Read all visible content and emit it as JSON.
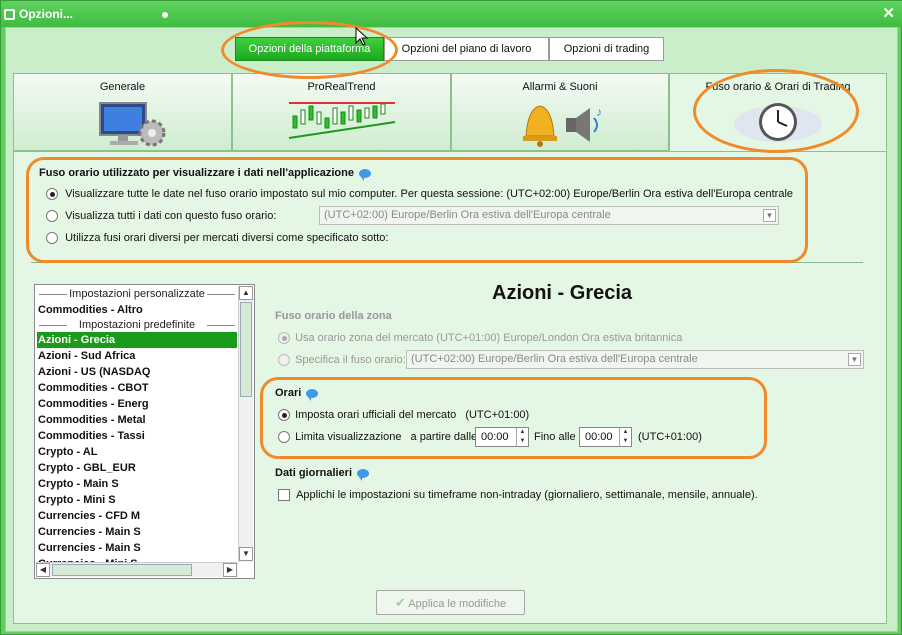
{
  "window": {
    "title": "Opzioni..."
  },
  "top_tabs": [
    "Opzioni della piattaforma",
    "Opzioni del piano di lavoro",
    "Opzioni di trading"
  ],
  "big_tabs": [
    "Generale",
    "ProRealTrend",
    "Allarmi & Suoni",
    "Fuso orario & Orari di Trading"
  ],
  "tz_section": {
    "header": "Fuso orario utilizzato per visualizzare i dati nell'applicazione",
    "opt1": "Visualizzare tutte le date nel fuso orario impostato sul mio computer. Per questa sessione: (UTC+02:00) Europe/Berlin Ora estiva dell'Europa centrale",
    "opt2": "Visualizza tutti i dati con questo fuso orario:",
    "opt2_value": "(UTC+02:00) Europe/Berlin Ora estiva dell'Europa centrale",
    "opt3": "Utilizza fusi orari diversi per mercati diversi come specificato sotto:"
  },
  "list": {
    "group1": "Impostazioni personalizzate",
    "item0": "Commodities - Altro",
    "group2": "Impostazioni predefinite",
    "items": [
      "Azioni - Grecia",
      "Azioni - Sud Africa",
      "Azioni - US (NASDAQ",
      "Commodities - CBOT",
      "Commodities - Energ",
      "Commodities - Metal",
      "Commodities - Tassi",
      "Crypto - AL",
      "Crypto - GBL_EUR",
      "Crypto - Main S",
      "Crypto - Mini S",
      "Currencies - CFD M",
      "Currencies - Main S",
      "Currencies - Main S",
      "Currencies - Mini S"
    ]
  },
  "detail": {
    "title": "Azioni - Grecia",
    "zone_header": "Fuso orario della zona",
    "zone_opt1": "Usa orario zona del mercato (UTC+01:00) Europe/London Ora estiva britannica",
    "zone_opt2": "Specifica il fuso orario:",
    "zone_opt2_value": "(UTC+02:00) Europe/Berlin Ora estiva dell'Europa centrale",
    "hours_header": "Orari",
    "hours_opt1": "Imposta orari ufficiali del mercato",
    "hours_opt1_tz": "(UTC+01:00)",
    "hours_opt2": "Limita visualizzazione",
    "from_label": "a partire dalle",
    "from_value": "00:00",
    "to_label": "Fino alle",
    "to_value": "00:00",
    "hours_tz": "(UTC+01:00)",
    "daily_header": "Dati giornalieri",
    "daily_opt": "Applichi le impostazioni su timeframe non-intraday (giornaliero, settimanale, mensile, annuale)."
  },
  "apply_button": "Applica le modifiche",
  "colors": {
    "accent": "#1b9b1b",
    "highlight": "#f08a2a"
  }
}
